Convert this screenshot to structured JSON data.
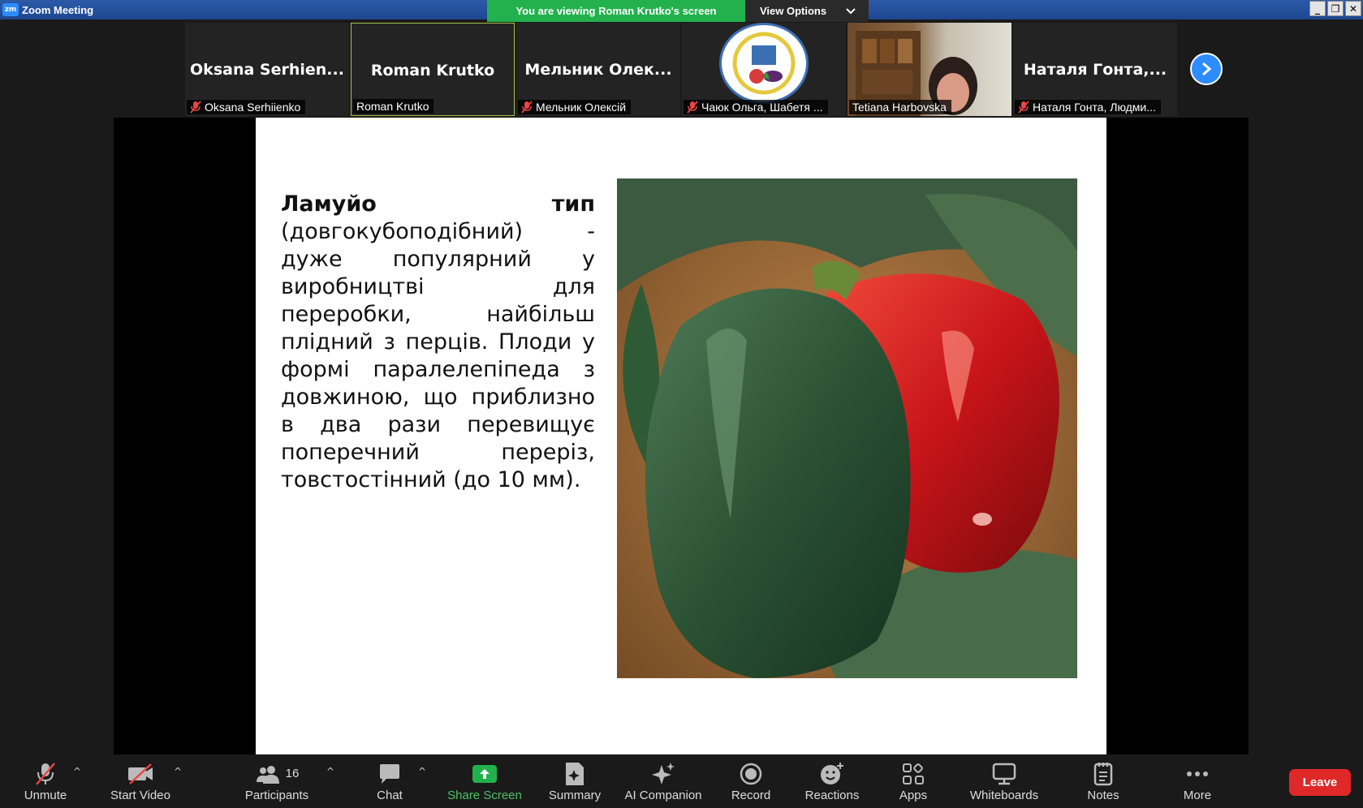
{
  "window": {
    "title": "Zoom Meeting",
    "logo": "zm"
  },
  "banner": {
    "text": "You are viewing Roman Krutko's screen",
    "view_options": "View Options"
  },
  "thumbnails": [
    {
      "big_name": "Oksana  Serhien...",
      "label": "Oksana Serhiienko",
      "muted": true
    },
    {
      "big_name": "Roman  Krutko",
      "label": "Roman Krutko",
      "muted": false,
      "active": true
    },
    {
      "big_name": "Мельник  Олек...",
      "label": "Мельник Олексій",
      "muted": true
    },
    {
      "big_name": "",
      "label": "Чаюк Ольга, Шабетя ...",
      "muted": true,
      "type": "logo"
    },
    {
      "big_name": "",
      "label": "Tetiana Harbovska",
      "muted": false,
      "type": "photo"
    },
    {
      "big_name": "Наталя  Гонта,...",
      "label": "Наталя Гонта, Людми...",
      "muted": true
    }
  ],
  "slide": {
    "heading_left": "Ламуйо",
    "heading_right": "тип",
    "body": "(довгокубоподібний) - дуже популярний у виробництві для переробки, найбільш плідний з перців. Плоди у формі паралелепіпеда з довжиною, що приблизно в два рази перевищує поперечний переріз, товстостінний (до 10 мм)."
  },
  "toolbar": {
    "unmute": "Unmute",
    "start_video": "Start Video",
    "participants": "Participants",
    "participants_count": "16",
    "chat": "Chat",
    "share_screen": "Share Screen",
    "summary": "Summary",
    "ai_companion": "AI Companion",
    "record": "Record",
    "reactions": "Reactions",
    "apps": "Apps",
    "whiteboards": "Whiteboards",
    "notes": "Notes",
    "more": "More",
    "leave": "Leave"
  },
  "colors": {
    "accent": "#2d8cff",
    "banner_green": "#23b14d",
    "leave_red": "#e02828",
    "share_green": "#4ec366",
    "mute_red": "#e84545"
  }
}
